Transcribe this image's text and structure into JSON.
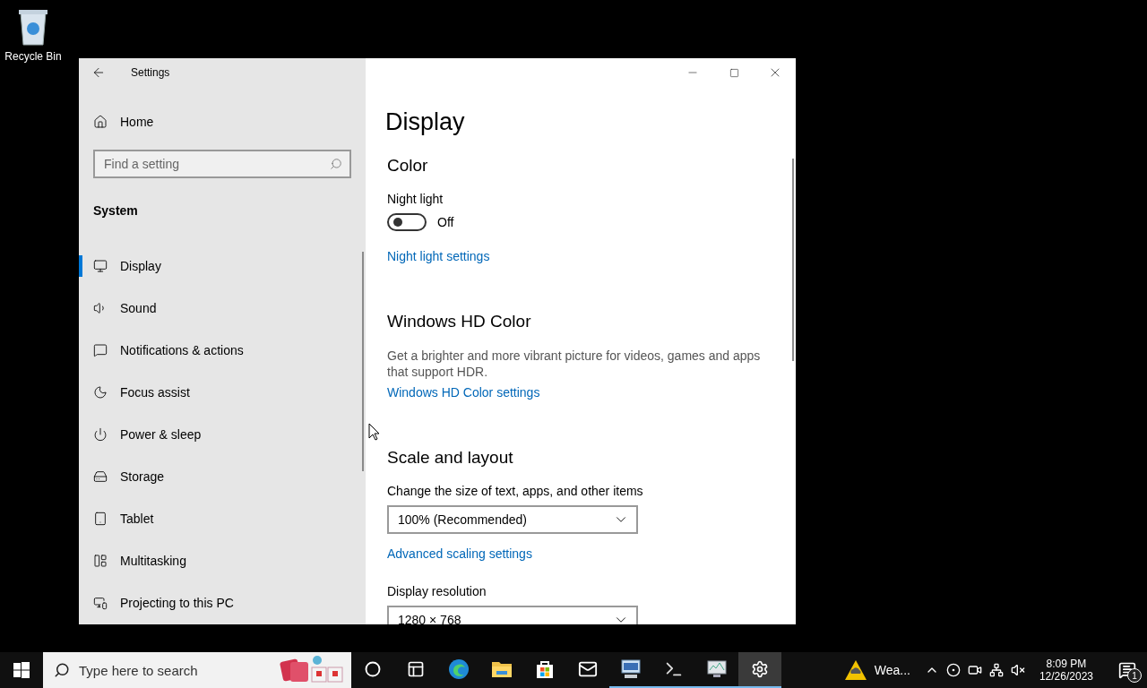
{
  "desktop": {
    "icons": [
      {
        "label": "Recycle Bin"
      }
    ]
  },
  "window": {
    "title": "Settings",
    "sidebar": {
      "home": "Home",
      "search": {
        "placeholder": "Find a setting"
      },
      "section": "System",
      "items": [
        {
          "label": "Display",
          "selected": true
        },
        {
          "label": "Sound",
          "selected": false
        },
        {
          "label": "Notifications & actions",
          "selected": false
        },
        {
          "label": "Focus assist",
          "selected": false
        },
        {
          "label": "Power & sleep",
          "selected": false
        },
        {
          "label": "Storage",
          "selected": false
        },
        {
          "label": "Tablet",
          "selected": false
        },
        {
          "label": "Multitasking",
          "selected": false
        },
        {
          "label": "Projecting to this PC",
          "selected": false
        }
      ]
    },
    "content": {
      "title": "Display",
      "sections": [
        {
          "heading": "Color",
          "rows": [
            {
              "kind": "label",
              "text": "Night light"
            },
            {
              "kind": "toggle",
              "on": false,
              "text": "Off"
            },
            {
              "kind": "link",
              "text": "Night light settings"
            }
          ]
        },
        {
          "heading": "Windows HD Color",
          "rows": [
            {
              "kind": "description",
              "text": "Get a brighter and more vibrant picture for videos, games and apps that support HDR."
            },
            {
              "kind": "link",
              "text": "Windows HD Color settings"
            }
          ]
        },
        {
          "heading": "Scale and layout",
          "rows": [
            {
              "kind": "label",
              "text": "Change the size of text, apps, and other items"
            },
            {
              "kind": "dropdown",
              "text": "100% (Recommended)"
            },
            {
              "kind": "link",
              "text": "Advanced scaling settings"
            },
            {
              "kind": "label",
              "text": "Display resolution"
            },
            {
              "kind": "dropdown",
              "text": "1280 × 768"
            }
          ]
        }
      ]
    }
  },
  "taskbar": {
    "search": {
      "placeholder": "Type here to search"
    },
    "apps": [
      {
        "running": false,
        "selected": false
      },
      {
        "running": false,
        "selected": false
      },
      {
        "running": false,
        "selected": false
      },
      {
        "running": false,
        "selected": false
      },
      {
        "running": false,
        "selected": false
      },
      {
        "running": false,
        "selected": false
      },
      {
        "running": true,
        "selected": false
      },
      {
        "running": true,
        "selected": false
      },
      {
        "running": true,
        "selected": false
      },
      {
        "running": true,
        "selected": true
      }
    ],
    "weather": "Wea...",
    "time": "8:09 PM",
    "date": "12/26/2023",
    "notifications": "1"
  }
}
